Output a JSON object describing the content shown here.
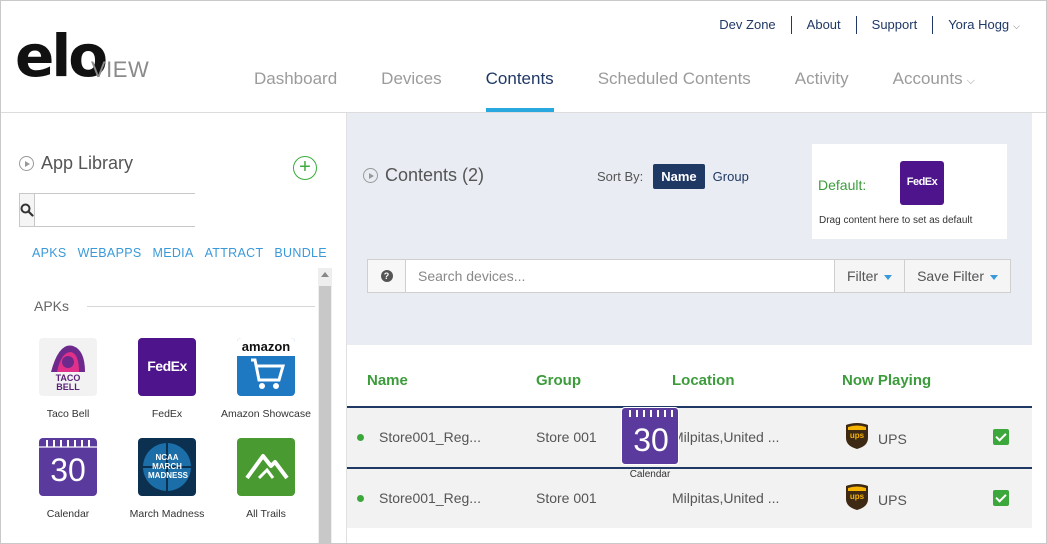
{
  "brand": {
    "logo_main": "elo",
    "logo_sub": "VIEW"
  },
  "topnav": [
    {
      "label": "Dev Zone"
    },
    {
      "label": "About"
    },
    {
      "label": "Support"
    },
    {
      "label": "Yora Hogg"
    }
  ],
  "mainnav": [
    {
      "label": "Dashboard"
    },
    {
      "label": "Devices"
    },
    {
      "label": "Contents"
    },
    {
      "label": "Scheduled Contents"
    },
    {
      "label": "Activity"
    },
    {
      "label": "Accounts"
    }
  ],
  "active_nav": "Contents",
  "library": {
    "title": "App Library",
    "search_placeholder": "",
    "tabs": [
      "APKS",
      "WEBAPPS",
      "MEDIA",
      "ATTRACT",
      "BUNDLE"
    ],
    "section": "APKs",
    "apps": [
      {
        "name": "Taco Bell",
        "icon": "taco-bell-icon"
      },
      {
        "name": "FedEx",
        "icon": "fedex-icon"
      },
      {
        "name": "Amazon Showcase",
        "icon": "amazon-icon"
      },
      {
        "name": "Calendar",
        "icon": "calendar-icon"
      },
      {
        "name": "March Madness",
        "icon": "march-madness-icon"
      },
      {
        "name": "All Trails",
        "icon": "all-trails-icon"
      }
    ]
  },
  "contents": {
    "title": "Contents (2)",
    "sort_by_label": "Sort By:",
    "sort_options": [
      "Name",
      "Group"
    ],
    "sort_active": "Name",
    "default_label": "Default:",
    "default_icon_text": "FedEx",
    "default_hint": "Drag content here to set as default",
    "search_placeholder": "Search devices...",
    "filter_label": "Filter",
    "save_filter_label": "Save Filter",
    "columns": [
      "Name",
      "Group",
      "Location",
      "Now Playing"
    ],
    "rows": [
      {
        "name": "Store001_Reg...",
        "group": "Store 001",
        "location": "Milpitas,United ...",
        "now_playing": "UPS",
        "checked": true
      },
      {
        "name": "Store001_Reg...",
        "group": "Store 001",
        "location": "Milpitas,United ...",
        "now_playing": "UPS",
        "checked": true
      }
    ]
  },
  "drag_ghost": {
    "name": "Calendar",
    "day": "30"
  },
  "icon_texts": {
    "taco_bell": "TACO BELL",
    "fedex": "FedEx",
    "amazon": "amazon",
    "calendar_day": "30",
    "march_madness": "NCAA MARCH MADNESS",
    "ups": "ups"
  },
  "colors": {
    "navy": "#1f3864",
    "accent_blue": "#29a8e0",
    "green": "#3ca83c",
    "fedex_purple": "#4d148c",
    "calendar_purple": "#5b3a9e",
    "panel_bg": "#e9edf3"
  }
}
